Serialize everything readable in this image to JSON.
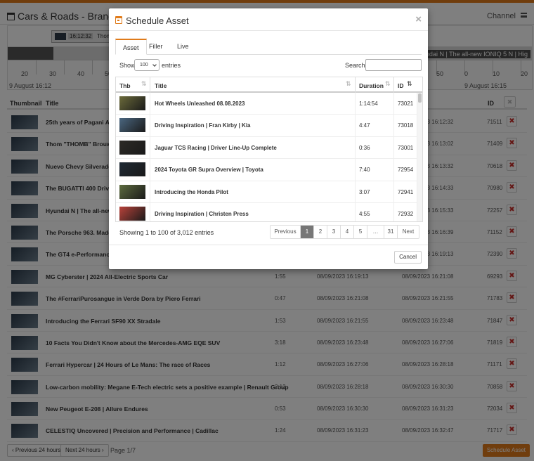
{
  "page": {
    "title": "Cars & Roads - Brands Play Ou",
    "channel_label": "Channel",
    "timeline": {
      "block_label": "Thom",
      "block_time": "16:12:32",
      "right_text": "Hyundai N | The all-new IONIQ 5 N | Hig",
      "ticks_left": [
        "20",
        "30",
        "40",
        "50"
      ],
      "ticks_right": [
        "50",
        "0",
        "10",
        "20"
      ],
      "date_left": "9 August 16:12",
      "date_right": "9 August 16:15"
    },
    "table_headers": {
      "thumbnail": "Thumbnail",
      "title": "Title",
      "id": "ID"
    },
    "rows": [
      {
        "title": "25th years of Pagani Auto",
        "duration": "",
        "start": "",
        "end": "08/09/2023 16:12:32",
        "id": "71511"
      },
      {
        "title": "Thom \"THOMB\" Brouwer",
        "duration": "",
        "start": "",
        "end": "08/09/2023 16:13:02",
        "id": "71409"
      },
      {
        "title": "Nuevo Chevy Silverado H",
        "duration": "",
        "start": "",
        "end": "08/09/2023 16:13:32",
        "id": "70618"
      },
      {
        "title": "The BUGATTI 400 Drive: A",
        "duration": "",
        "start": "",
        "end": "08/09/2023 16:14:33",
        "id": "70980"
      },
      {
        "title": "Hyundai N | The all-new",
        "duration": "",
        "start": "",
        "end": "08/09/2023 16:15:33",
        "id": "72257"
      },
      {
        "title": "The Porsche 963. Made fo",
        "duration": "",
        "start": "",
        "end": "08/09/2023 16:16:39",
        "id": "71152"
      },
      {
        "title": "The GT4 e-Performance t",
        "duration": "",
        "start": "",
        "end": "08/09/2023 16:19:13",
        "id": "72390"
      },
      {
        "title": "MG Cyberster | 2024 All-Electric Sports Car",
        "duration": "1:55",
        "start": "08/09/2023 16:19:13",
        "end": "08/09/2023 16:21:08",
        "id": "69293"
      },
      {
        "title": "The #FerrariPurosangue in Verde Dora by Piero Ferrari",
        "duration": "0:47",
        "start": "08/09/2023 16:21:08",
        "end": "08/09/2023 16:21:55",
        "id": "71783"
      },
      {
        "title": "Introducing the Ferrari SF90 XX Stradale",
        "duration": "1:53",
        "start": "08/09/2023 16:21:55",
        "end": "08/09/2023 16:23:48",
        "id": "71847"
      },
      {
        "title": "10 Facts You Didn't Know about the Mercedes-AMG EQE SUV",
        "duration": "3:18",
        "start": "08/09/2023 16:23:48",
        "end": "08/09/2023 16:27:06",
        "id": "71819"
      },
      {
        "title": "Ferrari Hypercar | 24 Hours of Le Mans: The race of Races",
        "duration": "1:12",
        "start": "08/09/2023 16:27:06",
        "end": "08/09/2023 16:28:18",
        "id": "71171"
      },
      {
        "title": "Low-carbon mobility: Megane E-Tech electric sets a positive example | Renault Group",
        "duration": "2:12",
        "start": "08/09/2023 16:28:18",
        "end": "08/09/2023 16:30:30",
        "id": "70858"
      },
      {
        "title": "New Peugeot E-208 | Allure Endures",
        "duration": "0:53",
        "start": "08/09/2023 16:30:30",
        "end": "08/09/2023 16:31:23",
        "id": "72034"
      },
      {
        "title": "CELESTIQ Uncovered | Precision and Performance | Cadillac",
        "duration": "1:24",
        "start": "08/09/2023 16:31:23",
        "end": "08/09/2023 16:32:47",
        "id": "71717"
      }
    ],
    "delete_glyph": "✖",
    "footer": {
      "prev_label": "‹ Previous 24 hours",
      "next_label": "Next 24 hours ›",
      "page_info": "Page 1/7",
      "schedule_label": "Schedule Asset"
    }
  },
  "modal": {
    "title": "Schedule Asset",
    "close_glyph": "×",
    "tabs": [
      "Asset",
      "Filler",
      "Live"
    ],
    "active_tab": "Asset",
    "show_label": "Show",
    "length_value": "100",
    "entries_label": "entries",
    "search_label": "Search:",
    "search_value": "",
    "columns": {
      "thb": "Thb",
      "title": "Title",
      "duration": "Duration",
      "id": "ID"
    },
    "sort_glyph": "⇅",
    "rows": [
      {
        "title": "Hot Wheels Unleashed 08.08.2023",
        "duration": "1:14:54",
        "id": "73021",
        "thumb_color": "#6b6a3a"
      },
      {
        "title": "Driving Inspiration | Fran Kirby | Kia",
        "duration": "4:47",
        "id": "73018",
        "thumb_color": "#4a6680"
      },
      {
        "title": "Jaguar TCS Racing | Driver Line-Up Complete",
        "duration": "0:36",
        "id": "73001",
        "thumb_color": "#2c2a26"
      },
      {
        "title": "2024 Toyota GR Supra Overview | Toyota",
        "duration": "7:40",
        "id": "72954",
        "thumb_color": "#1f2a35"
      },
      {
        "title": "Introducing the Honda Pilot",
        "duration": "3:07",
        "id": "72941",
        "thumb_color": "#5c6b3e"
      },
      {
        "title": "Driving Inspiration | Christen Press",
        "duration": "4:55",
        "id": "72932",
        "thumb_color": "#b8423a"
      }
    ],
    "showing_text": "Showing 1 to 100 of 3,012 entries",
    "pagination": [
      "Previous",
      "1",
      "2",
      "3",
      "4",
      "5",
      "…",
      "31",
      "Next"
    ],
    "active_page": "1",
    "cancel_label": "Cancel"
  },
  "colors": {
    "accent": "#e07b1a",
    "danger": "#c9302c",
    "active_page": "#777777"
  }
}
